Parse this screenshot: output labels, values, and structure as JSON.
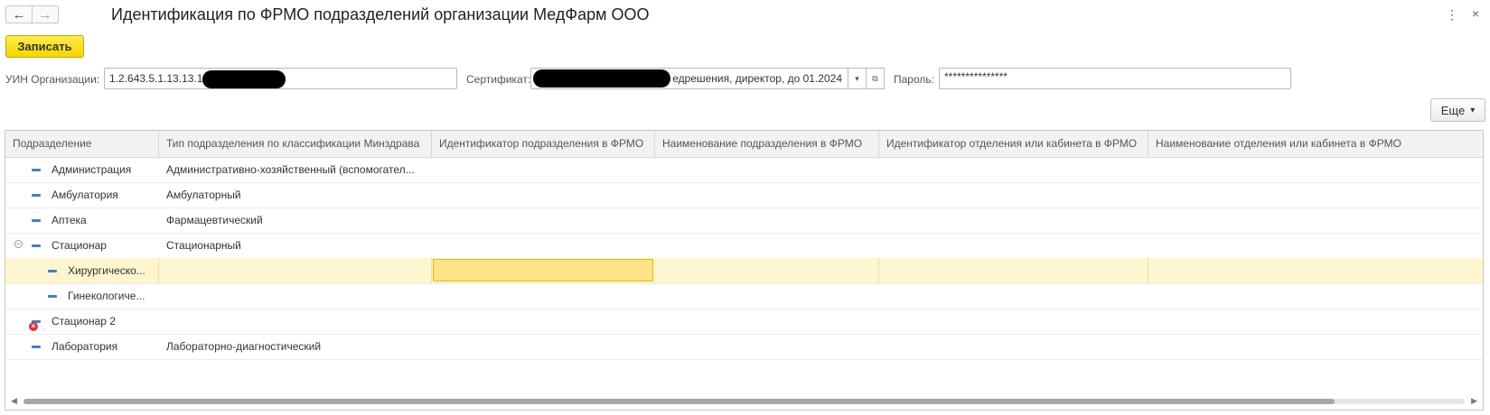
{
  "window": {
    "title": "Идентификация по ФРМО подразделений организации МедФарм ООО",
    "back_icon": "←",
    "forward_icon": "→",
    "menu_icon": "⋮",
    "close_icon": "×"
  },
  "toolbar": {
    "save_label": "Записать",
    "more_label": "Еще",
    "more_arrow": "▾"
  },
  "form": {
    "uin_label": "УИН Организации:",
    "uin_value": "1.2.643.5.1.13.13.1",
    "cert_label": "Сертификат:",
    "cert_value_visible": "едрешения, директор, до 01.2024",
    "cert_dropdown_icon": "▾",
    "cert_open_icon": "⧉",
    "password_label": "Пароль:",
    "password_value": "***************"
  },
  "table": {
    "columns": [
      "Подразделение",
      "Тип подразделения по классификации Минздрава",
      "Идентификатор подразделения в ФРМО",
      "Наименование подразделения в ФРМО",
      "Идентификатор отделения или кабинета в ФРМО",
      "Наименование отделения или кабинета в ФРМО"
    ],
    "rows": [
      {
        "name": "Администрация",
        "type": "Административно-хозяйственный (вспомогател..."
      },
      {
        "name": "Амбулатория",
        "type": "Амбулаторный"
      },
      {
        "name": "Аптека",
        "type": "Фармацевтический"
      },
      {
        "name": "Стационар",
        "type": "Стационарный",
        "expanded": true
      },
      {
        "name": "Хирургическо...",
        "type": "",
        "child": true,
        "selected": true
      },
      {
        "name": "Гинекологиче...",
        "type": "",
        "child": true
      },
      {
        "name": "Стационар 2",
        "type": "",
        "deleted": true
      },
      {
        "name": "Лаборатория",
        "type": "Лабораторно-диагностический"
      }
    ]
  },
  "colors": {
    "accent": "#f5d500",
    "selected_row": "#fff5cf",
    "active_cell": "#ffe48a",
    "item_icon": "#4a7bbd",
    "deleted": "#d9363e"
  }
}
